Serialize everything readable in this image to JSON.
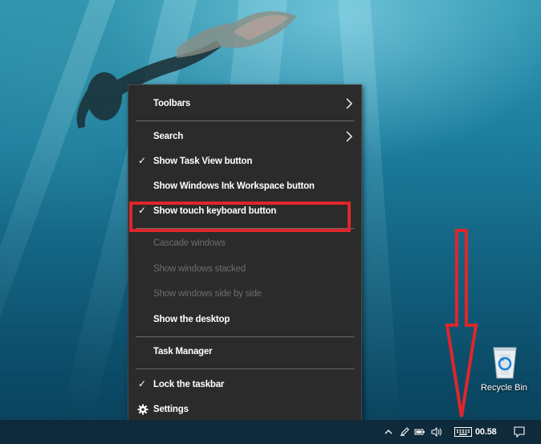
{
  "context_menu": {
    "items": [
      {
        "label": "Toolbars",
        "submenu": true
      },
      {
        "label": "Search",
        "submenu": true
      },
      {
        "label": "Show Task View button",
        "checked": true
      },
      {
        "label": "Show Windows Ink Workspace button",
        "checked": false
      },
      {
        "label": "Show touch keyboard button",
        "checked": true,
        "highlighted": true
      },
      {
        "label": "Cascade windows",
        "disabled": true
      },
      {
        "label": "Show windows stacked",
        "disabled": true
      },
      {
        "label": "Show windows side by side",
        "disabled": true
      },
      {
        "label": "Show the desktop"
      },
      {
        "label": "Task Manager"
      },
      {
        "label": "Lock the taskbar",
        "checked": true
      },
      {
        "label": "Settings",
        "icon": "gear-icon"
      }
    ]
  },
  "desktop": {
    "recycle_bin_label": "Recycle Bin"
  },
  "taskbar": {
    "clock": "00.58",
    "tray_icons": [
      "chevron-up-icon",
      "pen-icon",
      "battery-icon",
      "speaker-icon",
      "keyboard-icon",
      "notification-icon"
    ]
  },
  "colors": {
    "menu_background": "#2b2b2b",
    "annotation_red": "#e0262b",
    "taskbar": "#0f2a3a"
  }
}
